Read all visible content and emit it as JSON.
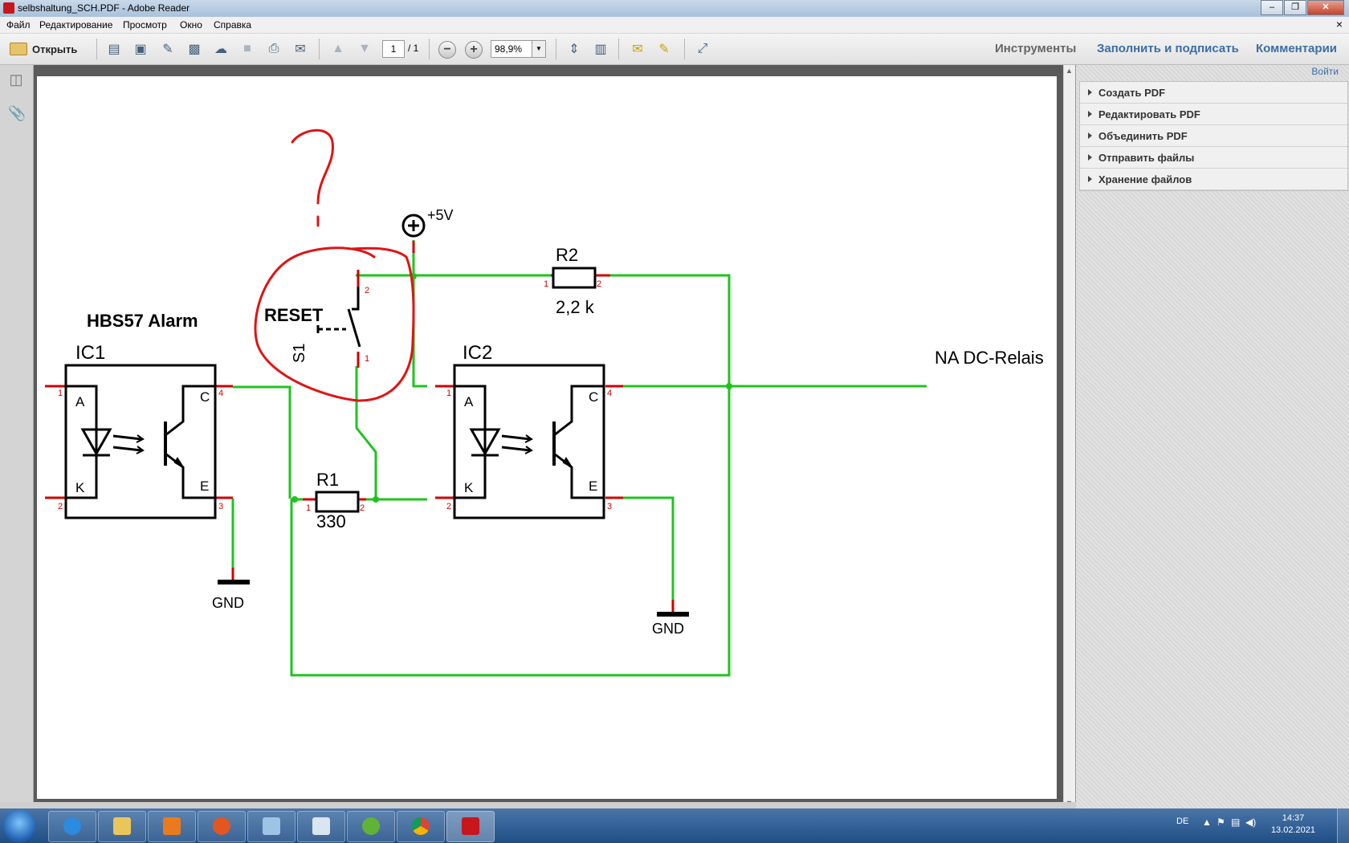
{
  "window": {
    "title": "selbshaltung_SCH.PDF - Adobe Reader",
    "btn_minimize": "–",
    "btn_maximize": "❐",
    "btn_close": "✕"
  },
  "menu": {
    "items": [
      "Файл",
      "Редактирование",
      "Просмотр",
      "Окно",
      "Справка"
    ],
    "close_glyph": "×"
  },
  "toolbar": {
    "open_label": "Открыть",
    "page_current": "1",
    "page_total": "/ 1",
    "zoom_out": "−",
    "zoom_in": "+",
    "zoom_value": "98,9%",
    "zoom_dropdown": "▼",
    "tools_label": "Инструменты",
    "fill_sign_label": "Заполнить и подписать",
    "comments_label": "Комментарии"
  },
  "right_panel": {
    "login": "Войти",
    "sections": [
      "Создать PDF",
      "Редактировать PDF",
      "Объединить PDF",
      "Отправить файлы",
      "Хранение файлов"
    ]
  },
  "schematic": {
    "question_mark": "?",
    "supply_label": "+5V",
    "r2_name": "R2",
    "r2_value": "2,2 k",
    "reset_label": "RESET",
    "s1_label": "S1",
    "s1_pin_top": "2",
    "s1_pin_bottom": "1",
    "hbs_title": "HBS57 Alarm",
    "ic1_name": "IC1",
    "ic2_name": "IC2",
    "output_label": "NA DC-Relais",
    "r1_name": "R1",
    "r1_value": "330",
    "gnd1_label": "GND",
    "gnd2_label": "GND",
    "pin_a": "A",
    "pin_k": "K",
    "pin_c": "C",
    "pin_e": "E",
    "pin_1": "1",
    "pin_2": "2",
    "pin_3": "3",
    "pin_4": "4",
    "wire_color": "#1fc31f",
    "pin_color": "#d00000",
    "annotation_color": "#e01414"
  },
  "taskbar": {
    "lang": "DE",
    "time": "14:37",
    "date": "13.02.2021",
    "tray_up": "▲",
    "tray_flag": "⚑",
    "tray_net": "▤",
    "tray_vol": "◀)"
  }
}
